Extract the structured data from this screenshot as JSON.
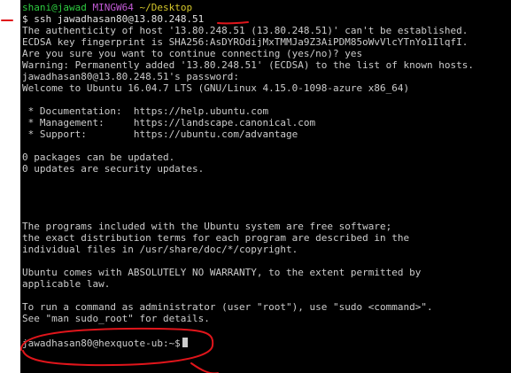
{
  "annotation_color": "#e0151b",
  "cursor_icon": "block-cursor",
  "bash": {
    "user_host": "shani@jawad",
    "env": "MINGW64",
    "path": "~/Desktop",
    "prompt_symbol": "$",
    "command": "ssh jawadhasan80@13.80.248.51"
  },
  "output": [
    "The authenticity of host '13.80.248.51 (13.80.248.51)' can't be established.",
    "ECDSA key fingerprint is SHA256:AsDYROdijMxTMMJa9Z3AiPDM85oWvVlcYTnYo1IlqfI.",
    "Are you sure you want to continue connecting (yes/no)? yes",
    "Warning: Permanently added '13.80.248.51' (ECDSA) to the list of known hosts.",
    "jawadhasan80@13.80.248.51's password:",
    "Welcome to Ubuntu 16.04.7 LTS (GNU/Linux 4.15.0-1098-azure x86_64)",
    "",
    " * Documentation:  https://help.ubuntu.com",
    " * Management:     https://landscape.canonical.com",
    " * Support:        https://ubuntu.com/advantage",
    "",
    "0 packages can be updated.",
    "0 updates are security updates.",
    "",
    "",
    "",
    "",
    "The programs included with the Ubuntu system are free software;",
    "the exact distribution terms for each program are described in the",
    "individual files in /usr/share/doc/*/copyright.",
    "",
    "Ubuntu comes with ABSOLUTELY NO WARRANTY, to the extent permitted by",
    "applicable law.",
    "",
    "To run a command as administrator (user \"root\"), use \"sudo <command>\".",
    "See \"man sudo_root\" for details.",
    ""
  ],
  "remote_prompt": "jawadhasan80@hexquote-ub:~$"
}
